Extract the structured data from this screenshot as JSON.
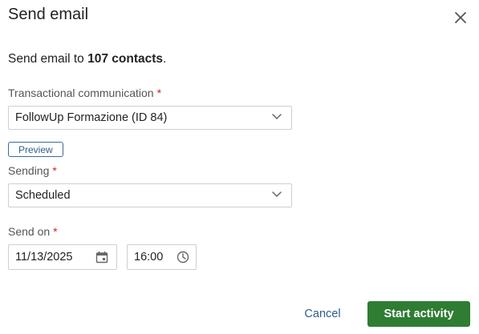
{
  "dialog": {
    "title": "Send email",
    "intro_prefix": "Send email to ",
    "intro_count": "107 contacts",
    "intro_suffix": "."
  },
  "form": {
    "transactional": {
      "label": "Transactional communication",
      "required": "*",
      "value": "FollowUp Formazione (ID 84)"
    },
    "preview_label": "Preview",
    "sending": {
      "label": "Sending",
      "required": "*",
      "value": "Scheduled"
    },
    "send_on": {
      "label": "Send on",
      "required": "*",
      "date": "11/13/2025",
      "time": "16:00"
    }
  },
  "actions": {
    "cancel": "Cancel",
    "start": "Start activity"
  },
  "colors": {
    "primary_button": "#2e7d32",
    "link": "#2f5e89",
    "required": "#c62828"
  },
  "icons": [
    "close-icon",
    "chevron-down-icon",
    "calendar-icon",
    "clock-icon"
  ]
}
